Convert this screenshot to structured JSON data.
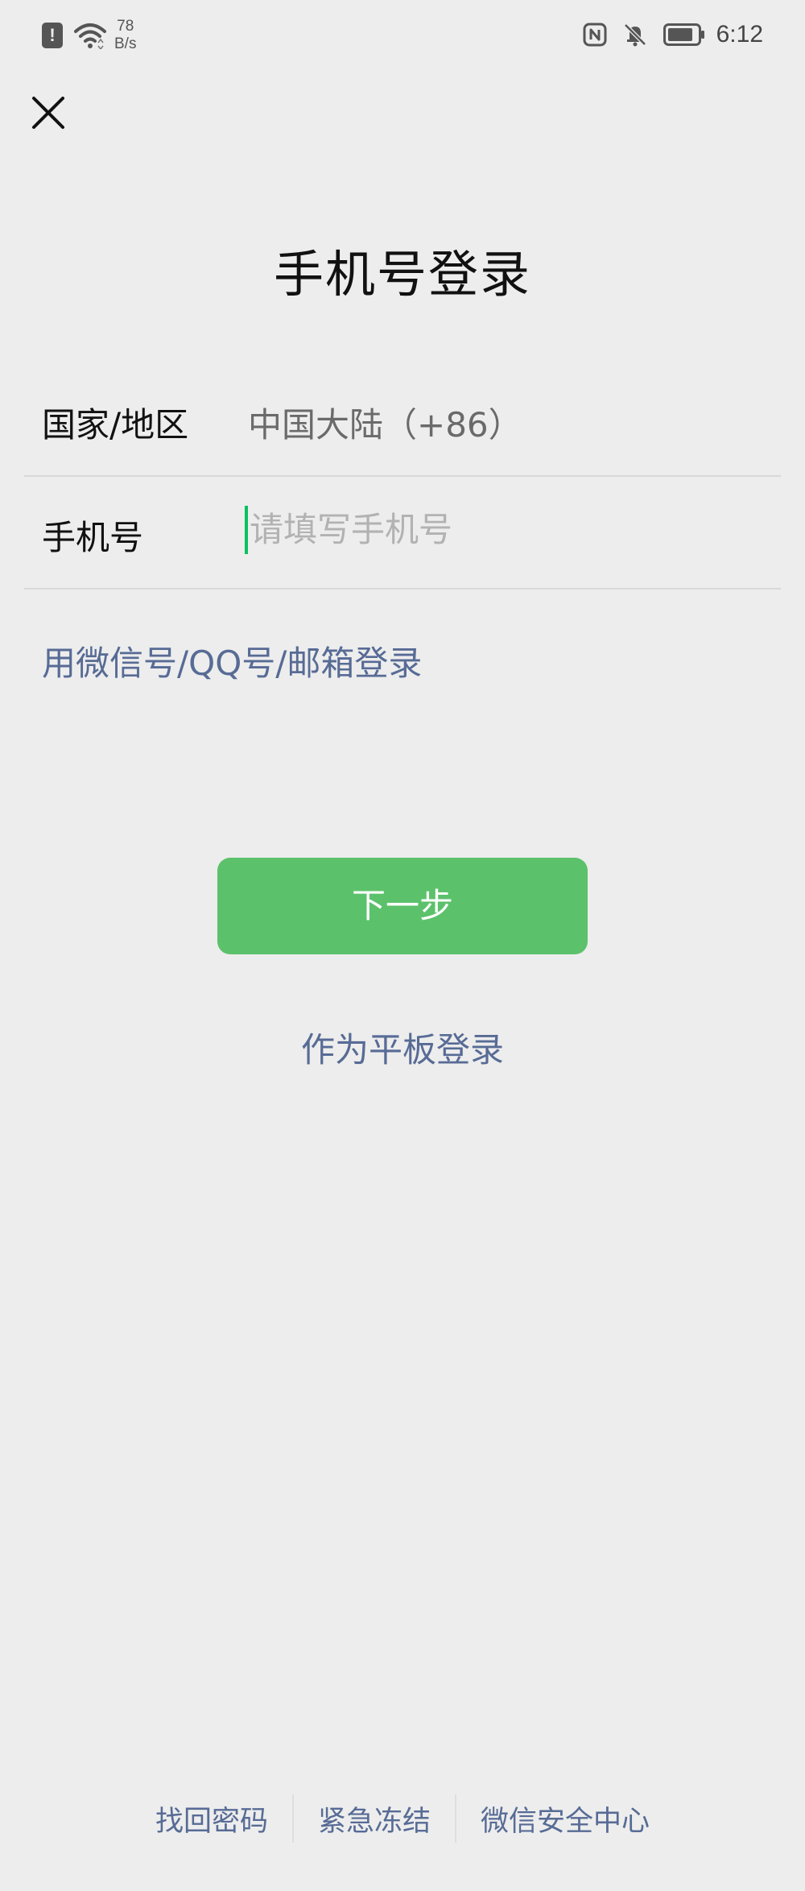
{
  "status_bar": {
    "net_speed_value": "78",
    "net_speed_unit": "B/s",
    "time": "6:12",
    "icons": [
      "alert-icon",
      "wifi-icon",
      "nfc-icon",
      "mute-icon",
      "battery-icon"
    ]
  },
  "header": {
    "close_icon": "close-icon"
  },
  "title": "手机号登录",
  "form": {
    "region": {
      "label": "国家/地区",
      "value": "中国大陆（+86）"
    },
    "phone": {
      "label": "手机号",
      "placeholder": "请填写手机号",
      "value": ""
    }
  },
  "alt_login_link": "用微信号/QQ号/邮箱登录",
  "next_button": "下一步",
  "tablet_link": "作为平板登录",
  "footer": {
    "links": [
      "找回密码",
      "紧急冻结",
      "微信安全中心"
    ]
  },
  "colors": {
    "background": "#ededed",
    "accent_green": "#5cc16b",
    "link_blue": "#576b95",
    "caret_green": "#07c160"
  }
}
